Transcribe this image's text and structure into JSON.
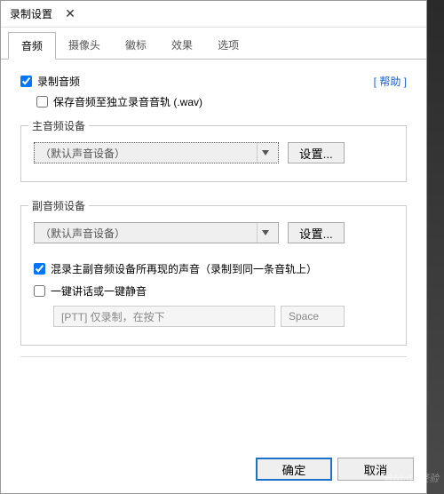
{
  "window": {
    "title": "录制设置"
  },
  "tabs": [
    "音频",
    "摄像头",
    "徽标",
    "效果",
    "选项"
  ],
  "activeTab": 0,
  "help_label": "[ 帮助 ]",
  "record_audio": {
    "label": "录制音频",
    "checked": true
  },
  "save_wav": {
    "label": "保存音频至独立录音音轨 (.wav)",
    "checked": false
  },
  "main_device": {
    "legend": "主音频设备",
    "selected": "（默认声音设备）",
    "settings_button": "设置..."
  },
  "sub_device": {
    "legend": "副音频设备",
    "selected": "（默认声音设备）",
    "settings_button": "设置...",
    "mix_both": {
      "label": "混录主副音频设备所再现的声音（录制到同一条音轨上）",
      "checked": true
    },
    "ptt_toggle": {
      "label": "一键讲话或一键静音",
      "checked": false
    },
    "ptt_text": "[PTT] 仅录制，在按下",
    "ptt_key": "Space"
  },
  "buttons": {
    "ok": "确定",
    "cancel": "取消"
  },
  "watermark": "Bai❀经验"
}
